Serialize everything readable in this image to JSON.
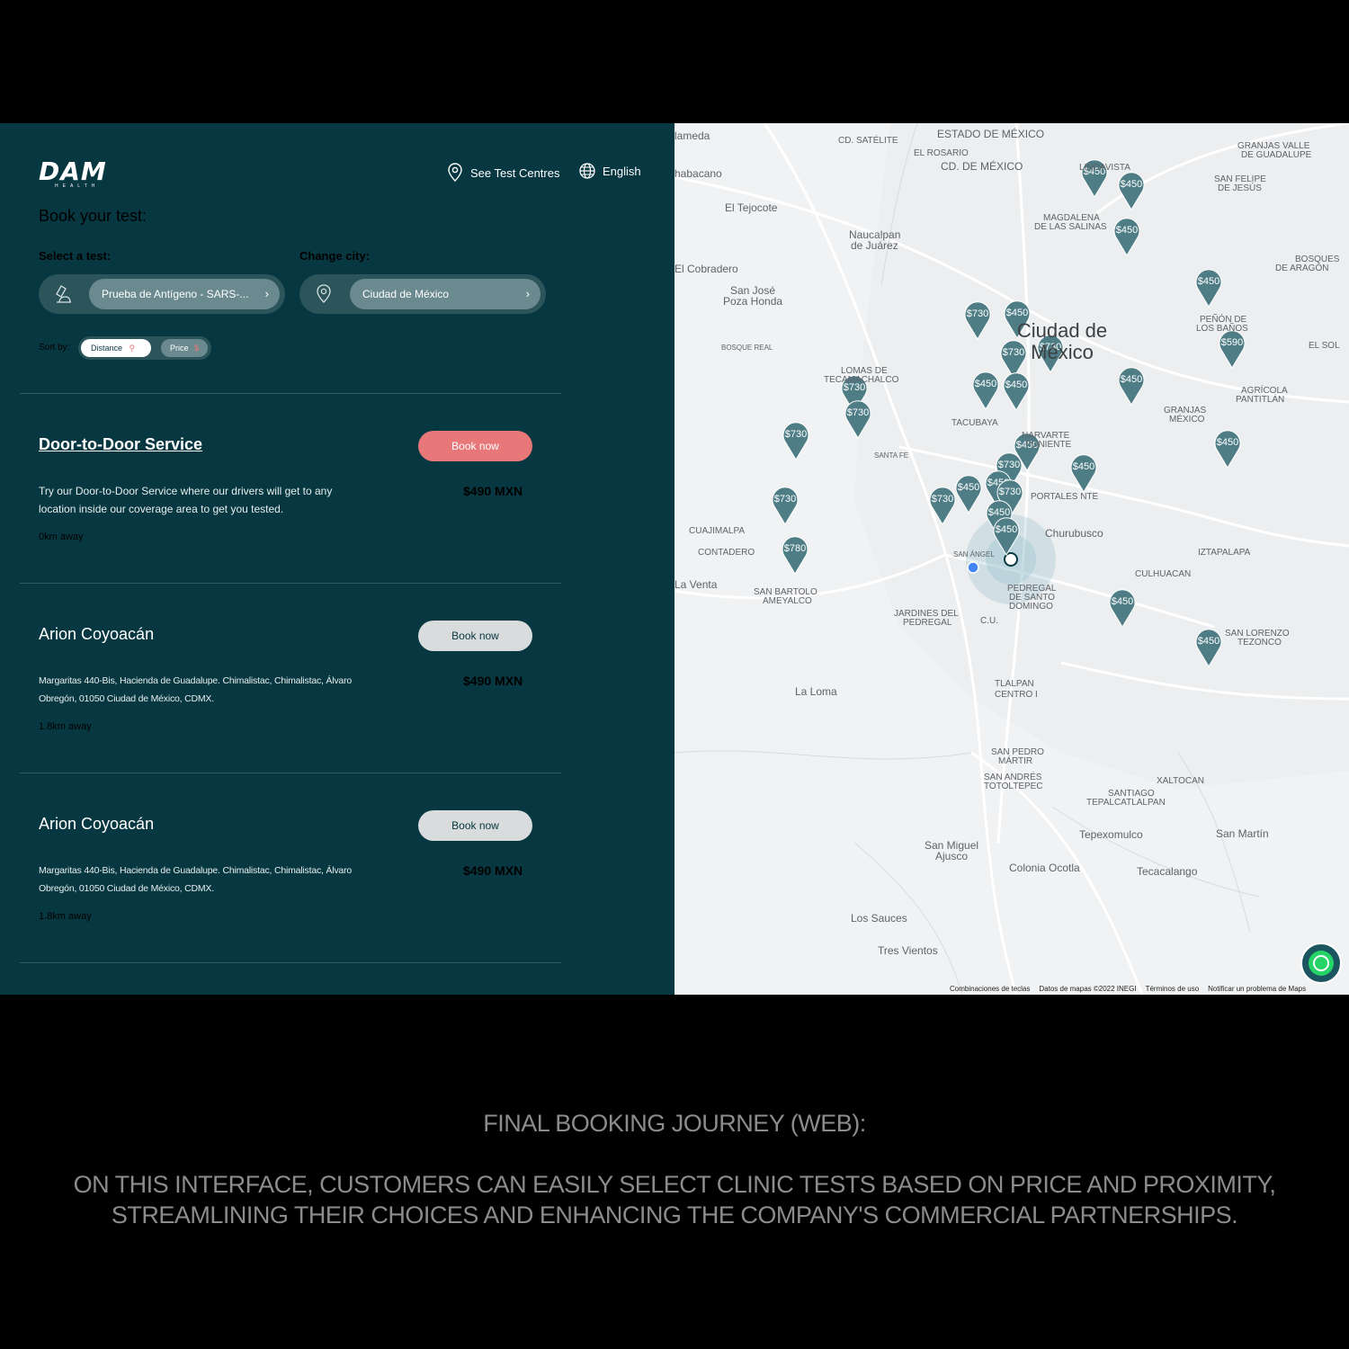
{
  "brand": {
    "name": "DAM",
    "sub": "HEALTH"
  },
  "header": {
    "see_centres": "See Test Centres",
    "language": "English"
  },
  "page_title": "Book your test:",
  "select_test": {
    "label": "Select a test:",
    "value": "Prueba de Antígeno - SARS-..."
  },
  "change_city": {
    "label": "Change city:",
    "value": "Ciudad de México"
  },
  "sort": {
    "label": "Sort by:",
    "option_distance": "Distance",
    "option_price": "Price",
    "price_symbol": "$",
    "selected": "Distance"
  },
  "cards": [
    {
      "title": "Door-to-Door Service",
      "button": "Book now",
      "price": "$490 MXN",
      "description": "Try our Door-to-Door Service where our drivers will get to any location inside our coverage area to get you tested.",
      "distance": "0km away"
    },
    {
      "title": "Arion Coyoacán",
      "button": "Book now",
      "price": "$490 MXN",
      "description": "Margaritas 440-Bis, Hacienda de Guadalupe. Chimalistac, Chimalistac, Álvaro Obregón, 01050 Ciudad de México, CDMX.",
      "distance": "1.8km away"
    },
    {
      "title": "Arion Coyoacán",
      "button": "Book now",
      "price": "$490 MXN",
      "description": "Margaritas 440-Bis, Hacienda de Guadalupe. Chimalistac, Chimalistac, Álvaro Obregón, 01050 Ciudad de México, CDMX.",
      "distance": "1.8km away"
    }
  ],
  "map": {
    "labels": {
      "city": "Ciudad de",
      "city2": "México",
      "cd_satelite": "CD. SATÉLITE",
      "estado_mexico": "ESTADO DE MÉXICO",
      "el_rosario": "EL ROSARIO",
      "cd_mexico": "CD. DE MÉXICO",
      "lindavista": "LINDAVISTA",
      "magdalena": "MAGDALENA",
      "salinas": "DE LAS SALINAS",
      "el_tejocote": "El Tejocote",
      "naucalpan": "Naucalpan",
      "naucalpan2": "de Juárez",
      "el_cobradero": "El Cobradero",
      "san_jose": "San José",
      "poza_honda": "Poza Honda",
      "bosque_real": "BOSQUE REAL",
      "lomas": "LOMAS DE",
      "tecamachalco": "TECAMACHALCO",
      "tacubaya": "TACUBAYA",
      "narvarte": "NARVARTE",
      "poniente": "PONIENTE",
      "portales": "PORTALES NTE",
      "churubusco": "Churubusco",
      "iztapalapa": "IZTAPALAPA",
      "culhuacan": "CULHUACAN",
      "pedregal": "PEDREGAL",
      "santo": "DE SANTO",
      "domingo": "DOMINGO",
      "jardines": "JARDINES DEL",
      "pedregal2": "PEDREGAL",
      "cuajimalpa": "CUAJIMALPA",
      "contadero": "CONTADERO",
      "la_venta": "La Venta",
      "san_bartolo": "SAN BARTOLO",
      "ameyalco": "AMEYALCO",
      "la_loma": "La Loma",
      "tlalpan": "TLALPAN",
      "tlalpan2": "CENTRO I",
      "san_pedro": "SAN PEDRO",
      "martir": "MÁRTIR",
      "san_andres": "SAN ANDRÉS",
      "totoltepec": "TOTOLTEPEC",
      "xaltocan": "XALTOCAN",
      "santiago": "SANTIAGO",
      "tepalcatlalpan": "TEPALCATLALPAN",
      "tepexomulco": "Tepexomulco",
      "san_martin": "San Martín",
      "colonia_ocotla": "Colonia Ocotla",
      "tecacalango": "Tecacalango",
      "los_sauces": "Los Sauces",
      "tres_vientos": "Tres Vientos",
      "san_miguel": "San Miguel",
      "ajusco": "Ajusco",
      "granjas": "GRANJAS",
      "granjas2": "MÉXICO",
      "agricola": "AGRÍCOLA",
      "pantitlan": "PANTITLÁN",
      "el_sol": "EL SOL",
      "penon": "PEÑÓN DE",
      "banos": "LOS BAÑOS",
      "san_lorenzo": "SAN LORENZO",
      "tezonco": "TEZONCO",
      "santa_fe": "SANTA FE",
      "san_angel": "SAN ÁNGEL",
      "cu": "C.U.",
      "alameda": "lameda",
      "chabacano": "habacano",
      "granjas_valle": "GRANJAS VALLE",
      "de_guadalupe": "DE GUADALUPE",
      "san_felipe": "SAN FELIPE",
      "de_jesus": "DE JESÚS",
      "bosques": "BOSQUES",
      "aragon": "DE ARAGÓN"
    },
    "pins": [
      "$450",
      "$450",
      "$450",
      "$450",
      "$730",
      "$450",
      "$730",
      "$730",
      "$450",
      "$450",
      "$450",
      "$590",
      "$730",
      "$730",
      "$730",
      "$450",
      "$450",
      "$730",
      "$450",
      "$450",
      "$730",
      "$730",
      "$450",
      "$730",
      "$450",
      "$780",
      "$450",
      "$450",
      "$450"
    ],
    "footer": {
      "shortcuts": "Combinaciones de teclas",
      "data": "Datos de mapas ©2022 INEGI",
      "terms": "Términos de uso",
      "report": "Notificar un problema de Maps"
    }
  },
  "caption": {
    "title": "FINAL BOOKING JOURNEY (WEB):",
    "line1": "ON THIS INTERFACE, CUSTOMERS CAN EASILY SELECT CLINIC TESTS BASED ON PRICE AND PROXIMITY,",
    "line2": "STREAMLINING THEIR CHOICES AND ENHANCING THE COMPANY'S COMMERCIAL PARTNERSHIPS."
  },
  "colors": {
    "panel": "#073740",
    "accent": "#e8777a",
    "pin": "#4f7d86",
    "map_bg": "#f1f2f3"
  }
}
